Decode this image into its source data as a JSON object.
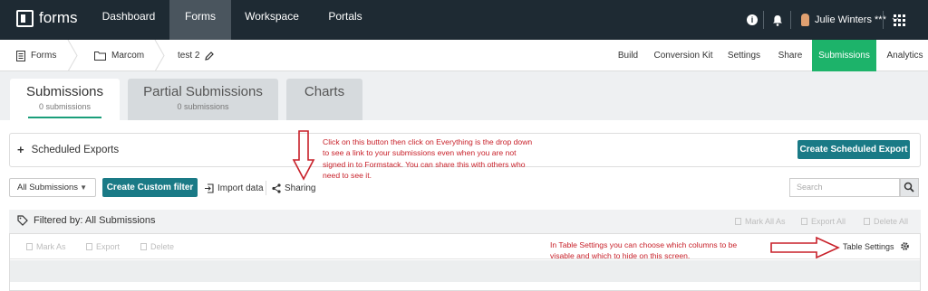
{
  "topnav": {
    "logo_text": "forms",
    "links": [
      "Dashboard",
      "Forms",
      "Workspace",
      "Portals"
    ],
    "active_link": "Forms",
    "user_name": "Julie Winters ***",
    "icons": [
      "info-icon",
      "bell-icon",
      "avatar",
      "chevron-down-icon",
      "apps-grid-icon"
    ]
  },
  "breadcrumb": {
    "items": [
      "Forms",
      "Marcom",
      "test 2"
    ],
    "icons": [
      "document-icon",
      "folder-icon",
      "pencil-icon"
    ]
  },
  "subtabs": {
    "items": [
      "Build",
      "Conversion Kit",
      "Settings",
      "Share",
      "Submissions",
      "Analytics"
    ],
    "active": "Submissions",
    "active_color": "#1db36a"
  },
  "tabs": [
    {
      "label": "Submissions",
      "sub": "0 submissions"
    },
    {
      "label": "Partial Submissions",
      "sub": "0 submissions"
    },
    {
      "label": "Charts",
      "sub": ""
    }
  ],
  "scheduled": {
    "label": "Scheduled Exports",
    "create_button": "Create Scheduled Export"
  },
  "filters": {
    "dropdown_value": "All Submissions",
    "create_filter_button": "Create Custom filter",
    "import_label": "Import data",
    "sharing_label": "Sharing",
    "search_placeholder": "Search"
  },
  "panel": {
    "title": "Filtered by: All Submissions",
    "top_actions": [
      "Mark All As",
      "Export All",
      "Delete All"
    ],
    "row_actions": [
      "Mark As",
      "Export",
      "Delete"
    ],
    "table_settings": "Table Settings"
  },
  "notes": {
    "sharing_note": [
      "Click on this button then click on Everything is the drop down",
      "to see a link to your submissions even when you are not",
      "signed in to Formstack. You can share this with others who",
      "need to see it."
    ],
    "table_note": [
      "In Table Settings you can choose which columns to be",
      "visable and which to hide on this screen."
    ],
    "note_color": "#c8212a"
  },
  "colors": {
    "topnav_bg": "#1e2a33",
    "teal_button": "#1a7a86",
    "tab_underline": "#1a9e7a"
  }
}
